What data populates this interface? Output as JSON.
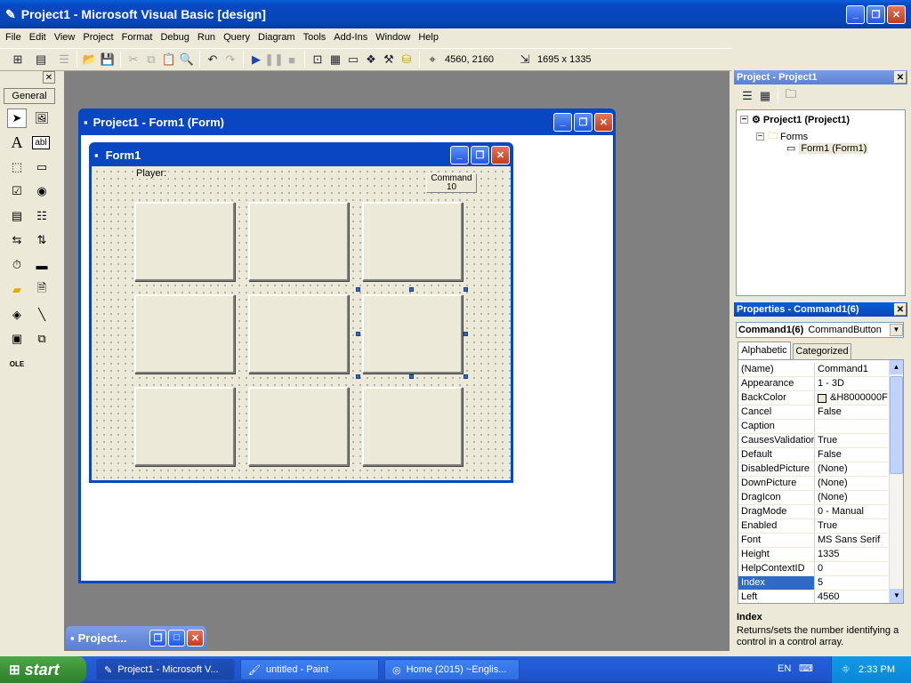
{
  "app": {
    "title": "Project1 - Microsoft Visual Basic [design]"
  },
  "menu": [
    "File",
    "Edit",
    "View",
    "Project",
    "Format",
    "Debug",
    "Run",
    "Query",
    "Diagram",
    "Tools",
    "Add-Ins",
    "Window",
    "Help"
  ],
  "toolbar": {
    "position": "4560, 2160",
    "size": "1695 x 1335"
  },
  "toolbox": {
    "header": "General"
  },
  "form_window": {
    "title": "Project1 - Form1 (Form)"
  },
  "form1": {
    "title": "Form1",
    "player_label": "Player:",
    "command10_caption": "Command\n10"
  },
  "minimized": {
    "label": "Project..."
  },
  "project_pane": {
    "title": "Project - Project1",
    "root": "Project1 (Project1)",
    "folder": "Forms",
    "item": "Form1 (Form1)"
  },
  "properties_pane": {
    "title": "Properties - Command1(6)",
    "object": "Command1(6)",
    "object_type": "CommandButton",
    "tab_alpha": "Alphabetic",
    "tab_cat": "Categorized",
    "rows": [
      {
        "k": "(Name)",
        "v": "Command1"
      },
      {
        "k": "Appearance",
        "v": "1 - 3D"
      },
      {
        "k": "BackColor",
        "v": "&H8000000F"
      },
      {
        "k": "Cancel",
        "v": "False"
      },
      {
        "k": "Caption",
        "v": ""
      },
      {
        "k": "CausesValidation",
        "v": "True"
      },
      {
        "k": "Default",
        "v": "False"
      },
      {
        "k": "DisabledPicture",
        "v": "(None)"
      },
      {
        "k": "DownPicture",
        "v": "(None)"
      },
      {
        "k": "DragIcon",
        "v": "(None)"
      },
      {
        "k": "DragMode",
        "v": "0 - Manual"
      },
      {
        "k": "Enabled",
        "v": "True"
      },
      {
        "k": "Font",
        "v": "MS Sans Serif"
      },
      {
        "k": "Height",
        "v": "1335"
      },
      {
        "k": "HelpContextID",
        "v": "0"
      },
      {
        "k": "Index",
        "v": "5"
      },
      {
        "k": "Left",
        "v": "4560"
      }
    ],
    "desc_title": "Index",
    "desc_text": "Returns/sets the number identifying a control in a control array."
  },
  "taskbar": {
    "start": "start",
    "tasks": [
      "Project1 - Microsoft V...",
      "untitled - Paint",
      "Home (2015) ~Englis..."
    ],
    "lang": "EN",
    "clock": "2:33 PM"
  }
}
